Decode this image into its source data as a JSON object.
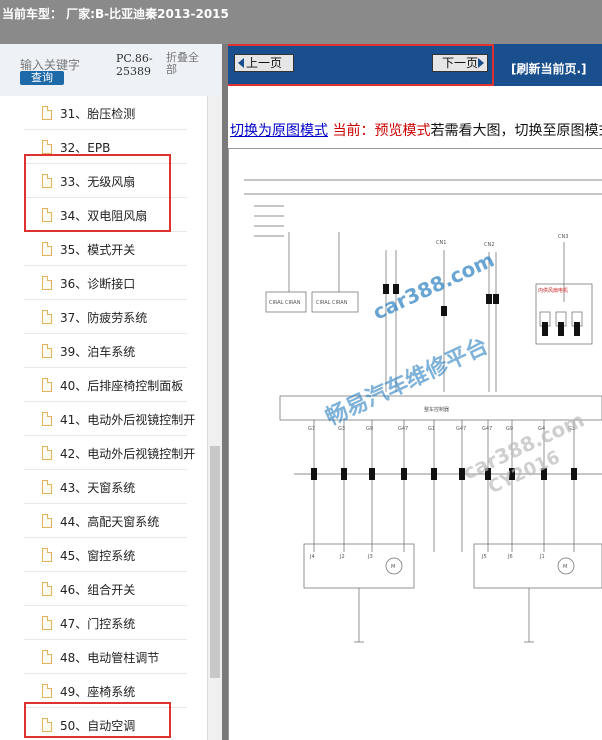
{
  "title": "当前车型：  厂家:B-比亚迪秦2013-2015",
  "search": {
    "keyword_label": "输入关键字",
    "search_button": "查询",
    "pc_code": [
      "PC.86-",
      "25389"
    ],
    "collapse_all": "折叠全部"
  },
  "tree": [
    {
      "label": "31、胎压检测"
    },
    {
      "label": "32、EPB"
    },
    {
      "label": "33、无级风扇"
    },
    {
      "label": "34、双电阻风扇"
    },
    {
      "label": "35、模式开关"
    },
    {
      "label": "36、诊断接口"
    },
    {
      "label": "37、防疲劳系统"
    },
    {
      "label": "39、泊车系统"
    },
    {
      "label": "40、后排座椅控制面板"
    },
    {
      "label": "41、电动外后视镜控制开"
    },
    {
      "label": "42、电动外后视镜控制开"
    },
    {
      "label": "43、天窗系统"
    },
    {
      "label": "44、高配天窗系统"
    },
    {
      "label": "45、窗控系统"
    },
    {
      "label": "46、组合开关"
    },
    {
      "label": "47、门控系统"
    },
    {
      "label": "48、电动管柱调节"
    },
    {
      "label": "49、座椅系统"
    },
    {
      "label": "50、自动空调"
    }
  ],
  "viewer": {
    "prev_label": "上一页",
    "next_label": "下一页",
    "refresh_label": "[刷新当前页.]",
    "mode_link": "切换为原图模式",
    "mode_current": "当前：预览模式",
    "mode_hint": "若需看大图，切换至原图模式"
  },
  "diagram": {
    "labels": {
      "cn1": "CN1",
      "cn2": "CN2",
      "cn3": "CN3",
      "motor": "M",
      "module_a": "CIRAL CIRAN",
      "module_b": "CIRAL CIRAN",
      "relay_label": "内供风扇电机",
      "box_label": "整车控制器",
      "pins": [
        "G7",
        "G3",
        "G9",
        "G47",
        "G1",
        "G47",
        "G47",
        "G9",
        "G4",
        "G3"
      ],
      "bottom_pins": [
        "J4",
        "J2",
        "J3",
        "J5",
        "J6",
        "J1"
      ]
    },
    "watermarks": {
      "site": "car388.com",
      "platform": "畅易汽车维修平台",
      "code": "CY2016"
    }
  },
  "colors": {
    "titlebar": "#8a8a8a",
    "navbar": "#1a4f8e",
    "highlight": "#e03131",
    "link": "#0000cc",
    "current_mode": "#cc0000",
    "watermark": "#2a7fc1"
  }
}
